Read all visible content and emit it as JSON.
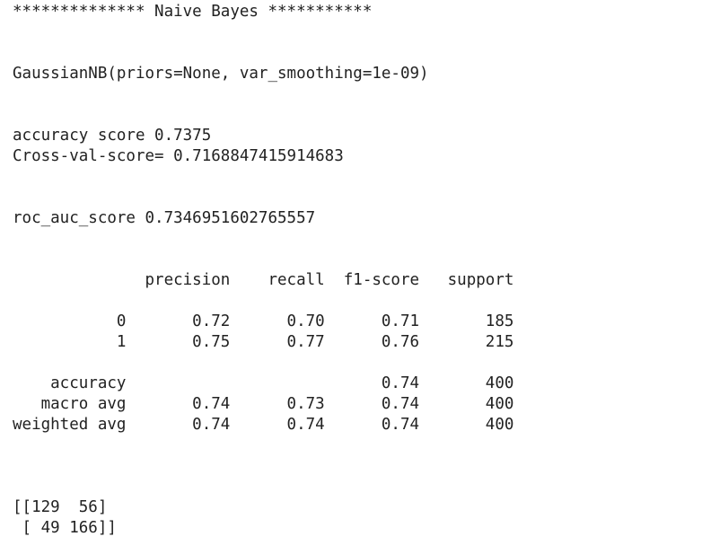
{
  "output_lines": [
    "************** Naive Bayes ***********",
    "",
    "",
    "GaussianNB(priors=None, var_smoothing=1e-09)",
    "",
    "",
    "accuracy score 0.7375",
    "Cross-val-score= 0.7168847415914683",
    "",
    "",
    "roc_auc_score 0.7346951602765557",
    "",
    "",
    "              precision    recall  f1-score   support",
    "",
    "           0       0.72      0.70      0.71       185",
    "           1       0.75      0.77      0.76       215",
    "",
    "    accuracy                           0.74       400",
    "   macro avg       0.74      0.73      0.74       400",
    "weighted avg       0.74      0.74      0.74       400",
    "",
    "",
    "",
    "[[129  56]",
    " [ 49 166]]"
  ]
}
